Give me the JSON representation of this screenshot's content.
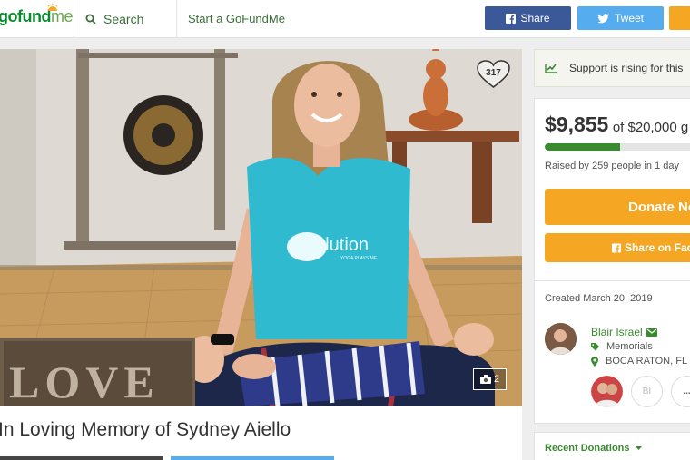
{
  "header": {
    "logo_text": "gofund",
    "logo_suffix": "me",
    "search_label": "Search",
    "start_label": "Start a GoFundMe",
    "share_label": "Share",
    "tweet_label": "Tweet"
  },
  "photo": {
    "heart_count": "317",
    "photo_count": "2",
    "shirt_text": "evolution",
    "shirt_subtext": "YOGA PLAYS ME",
    "sign_text": "LOVE"
  },
  "campaign": {
    "title": "In Loving Memory of Sydney Aiello"
  },
  "sidebar": {
    "rising_text": "Support is rising for this",
    "raised_amount": "$9,855",
    "goal_text": "of $20,000 g",
    "progress_fraction": 0.49,
    "raised_by": "Raised by 259 people in 1 day",
    "donate_label": "Donate No",
    "share_fb_label": "Share on Face",
    "created": "Created March 20, 2019",
    "organizer_name": "Blair Israel",
    "category": "Memorials",
    "location": "BOCA RATON, FL",
    "team_initials": "BI",
    "more_label": "...",
    "recent_donations": "Recent Donations"
  },
  "colors": {
    "brand_green": "#3a8a2f",
    "facebook": "#3b5998",
    "twitter": "#55acee",
    "donate_orange": "#f5a623"
  }
}
